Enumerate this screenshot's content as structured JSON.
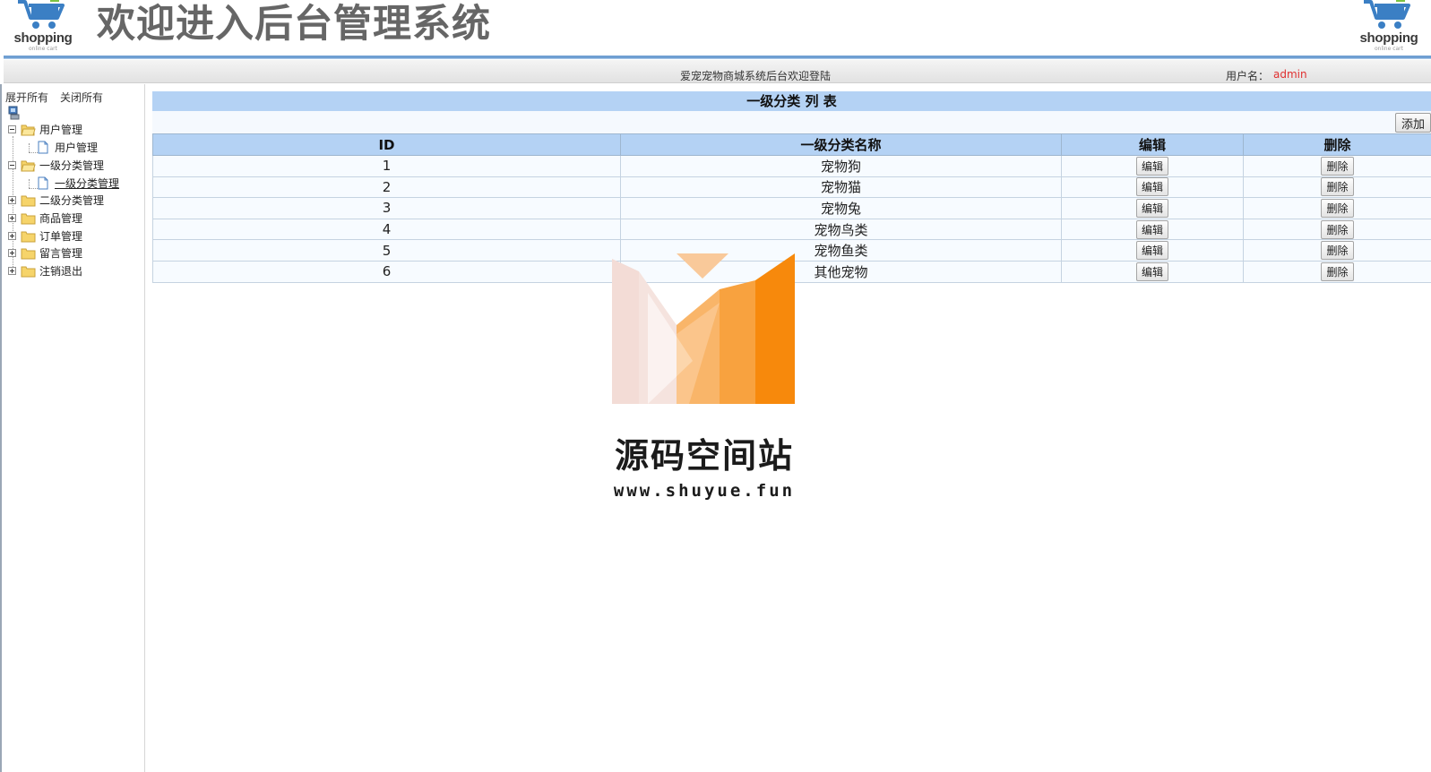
{
  "header": {
    "title": "欢迎进入后台管理系统",
    "logo_text": "shopping",
    "logo_subtext": "online cart"
  },
  "statusbar": {
    "welcome": "爱宠宠物商城系统后台欢迎登陆",
    "user_label": "用户名：",
    "user_name": "admin"
  },
  "sidebar": {
    "expand_all": "展开所有",
    "collapse_all": "关闭所有",
    "items": [
      {
        "label": "用户管理",
        "children": [
          {
            "label": "用户管理"
          }
        ]
      },
      {
        "label": "一级分类管理",
        "children": [
          {
            "label": "一级分类管理"
          }
        ]
      },
      {
        "label": "二级分类管理"
      },
      {
        "label": "商品管理"
      },
      {
        "label": "订单管理"
      },
      {
        "label": "留言管理"
      },
      {
        "label": "注销退出"
      }
    ]
  },
  "main": {
    "panel_title": "一级分类 列 表",
    "add_label": "添加",
    "columns": [
      "ID",
      "一级分类名称",
      "编辑",
      "删除"
    ],
    "edit_label": "编辑",
    "delete_label": "删除",
    "rows": [
      {
        "id": "1",
        "name": "宠物狗"
      },
      {
        "id": "2",
        "name": "宠物猫"
      },
      {
        "id": "3",
        "name": "宠物兔"
      },
      {
        "id": "4",
        "name": "宠物鸟类"
      },
      {
        "id": "5",
        "name": "宠物鱼类"
      },
      {
        "id": "6",
        "name": "其他宠物"
      }
    ]
  },
  "watermark": {
    "title": "源码空间站",
    "url": "www.shuyue.fun"
  },
  "colors": {
    "header_line": "#6f9fd2",
    "table_header": "#b4d2f4",
    "user_name": "#e03030",
    "watermark_orange": "#f7890c"
  }
}
